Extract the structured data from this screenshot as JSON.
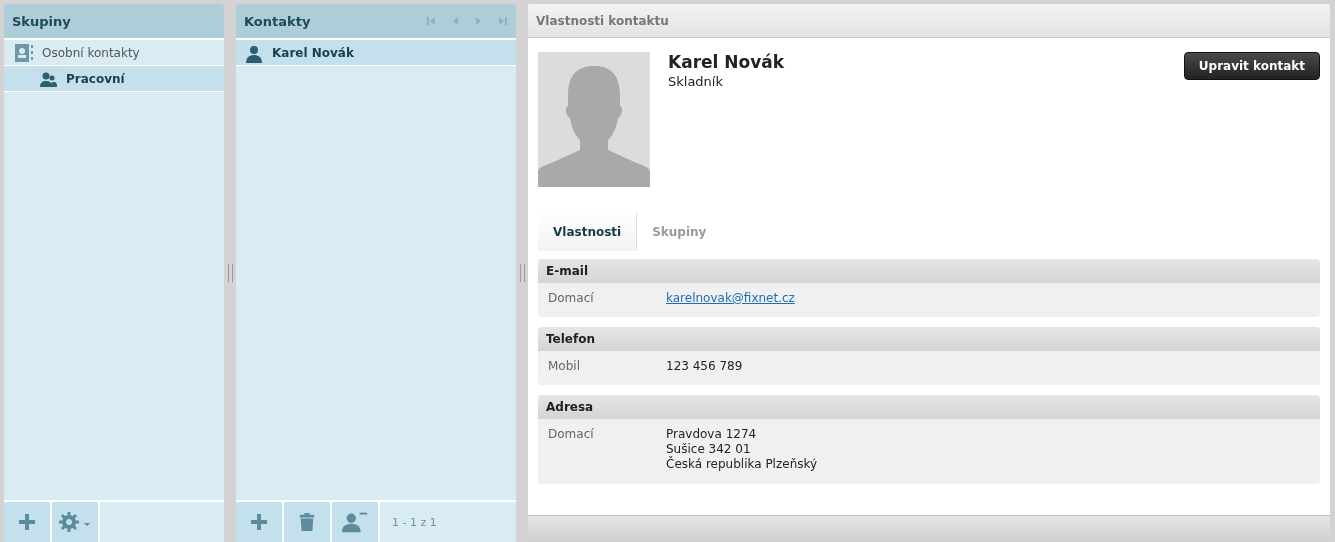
{
  "groups": {
    "title": "Skupiny",
    "items": [
      {
        "label": "Osobní kontakty",
        "selected": false,
        "children": [
          {
            "label": "Pracovní",
            "selected": true
          }
        ]
      }
    ]
  },
  "contacts": {
    "title": "Kontakty",
    "items": [
      {
        "name": "Karel Novák",
        "selected": true
      }
    ],
    "pager": "1 - 1 z 1"
  },
  "detail": {
    "title": "Vlastnosti kontaktu",
    "name": "Karel Novák",
    "job": "Skladník",
    "edit_button": "Upravit kontakt",
    "tabs": [
      {
        "label": "Vlastnosti",
        "selected": true
      },
      {
        "label": "Skupiny",
        "selected": false
      }
    ],
    "sections": [
      {
        "title": "E-mail",
        "rows": [
          {
            "label": "Domací",
            "kind": "link",
            "lines": [
              "karelnovak@fixnet.cz"
            ]
          }
        ]
      },
      {
        "title": "Telefon",
        "rows": [
          {
            "label": "Mobil",
            "kind": "text",
            "lines": [
              "123 456 789"
            ]
          }
        ]
      },
      {
        "title": "Adresa",
        "rows": [
          {
            "label": "Domací",
            "kind": "text",
            "lines": [
              "Pravdova 1274",
              "Sušice 342 01",
              "Česká republika Plzeňský"
            ]
          }
        ]
      }
    ]
  }
}
